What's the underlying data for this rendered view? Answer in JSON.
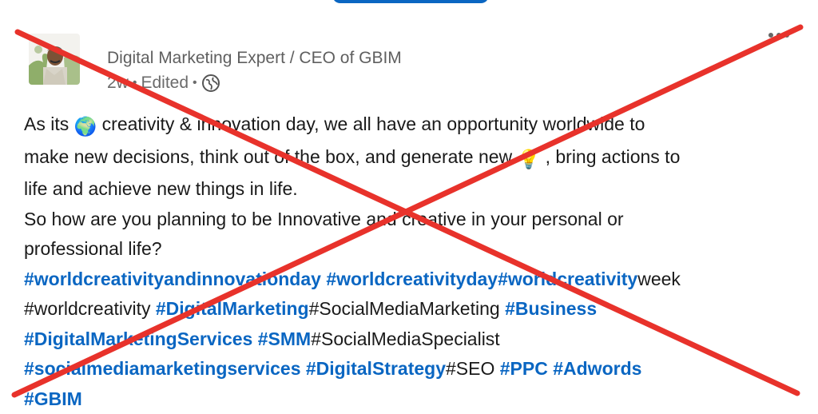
{
  "author": {
    "headline": "Digital Marketing Expert / CEO of GBIM",
    "time": "2w",
    "edited": "Edited",
    "separator": "•"
  },
  "post": {
    "line1": {
      "a": "As its",
      "emoji": "🌍",
      "b": "creativity & innovation day, we all have an opportunity worldwide to"
    },
    "line2": {
      "a": "make new decisions, think out of the box, and generate new",
      "emoji": "💡",
      "b": ", bring actions to"
    },
    "line3": "life and achieve new things in life.",
    "line4": "So how are you planning to be Innovative and creative in your personal or",
    "line5": "professional life?",
    "line6": {
      "tag1": "#worldcreativityandinnovationday",
      "tag2": "#worldcreativityday",
      "tag3": "#worldcreativity",
      "tail": "week"
    },
    "line7": {
      "plain1": "#worldcreativity",
      "tag1": "#DigitalMarketing",
      "plain2": "#SocialMediaMarketing",
      "tag2": "#Business"
    },
    "line8": {
      "tag1": "#DigitalMarketingServices",
      "tag2": "#SMM",
      "plain1": "#SocialMediaSpecialist"
    },
    "line9": {
      "tag1": "#socialmediamarketingservices",
      "tag2": "#DigitalStrategy",
      "plain1": "#SEO",
      "tag3": "#PPC",
      "tag4": "#Adwords"
    },
    "line10": {
      "tag1": "#GBIM"
    }
  },
  "icons": {
    "globe": "globe-icon",
    "more": "more-options-icon",
    "cross": "red-x-overlay"
  },
  "colors": {
    "hashtag": "#0a66c2",
    "cross": "#e8322b",
    "text": "#1a1a1a"
  }
}
